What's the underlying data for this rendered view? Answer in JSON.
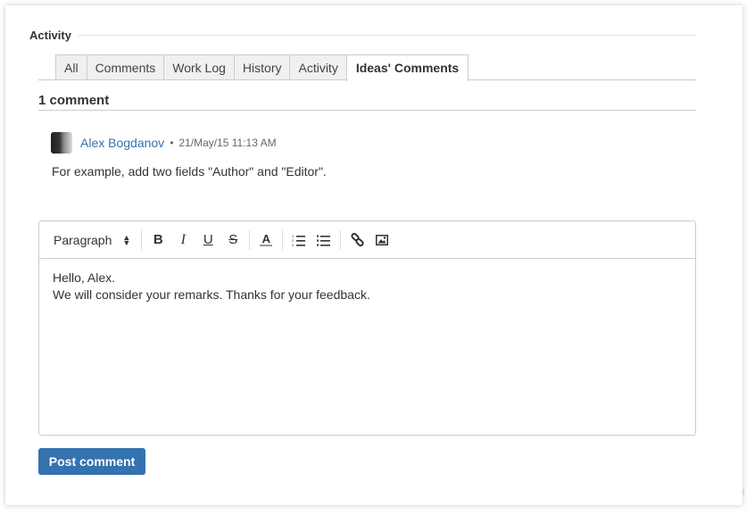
{
  "section": {
    "title": "Activity"
  },
  "tabs": [
    {
      "label": "All",
      "active": false
    },
    {
      "label": "Comments",
      "active": false
    },
    {
      "label": "Work Log",
      "active": false
    },
    {
      "label": "History",
      "active": false
    },
    {
      "label": "Activity",
      "active": false
    },
    {
      "label": "Ideas' Comments",
      "active": true
    }
  ],
  "comments": {
    "count_label": "1 comment",
    "items": [
      {
        "author": "Alex Bogdanov",
        "separator": "•",
        "timestamp": "21/May/15 11:13 AM",
        "body": "For example, add two fields \"Author\" and \"Editor\"."
      }
    ]
  },
  "editor": {
    "format_select": "Paragraph",
    "toolbar": {
      "bold": "B",
      "italic": "I",
      "underline": "U",
      "strike": "S",
      "text_color": "A"
    },
    "content_lines": [
      "Hello, Alex.",
      "We will consider your remarks. Thanks for your feedback."
    ]
  },
  "actions": {
    "post_label": "Post comment"
  },
  "colors": {
    "accent": "#3572b0",
    "border": "#cccccc",
    "tab_bg": "#f0f0f0"
  }
}
